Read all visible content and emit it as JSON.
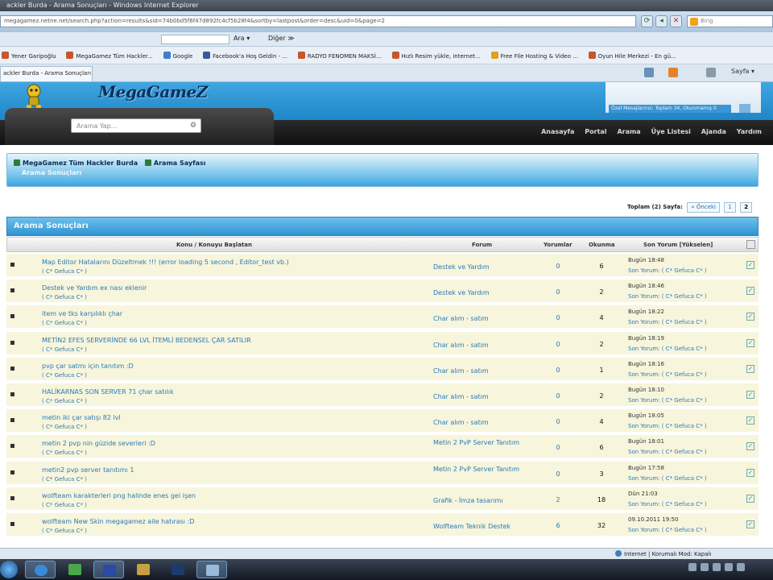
{
  "browser": {
    "window_title": "ackler Burda - Arama Sonuçları - Windows Internet Explorer",
    "url": "megagamez.netne.net/search.php?action=results&sid=74b0bd5f6f47d892fc4cf5b28f4&sortby=lastpost&order=desc&uid=0&page=2",
    "search_placeholder": "Bing",
    "menu_ara": "Ara ▾",
    "menu_diger": "Diğer ≫",
    "favorites": [
      "Yener Garipoğlu",
      "MegaGamez Tüm Hackler...",
      "Google",
      "Facebook'a Hoş Geldin - ...",
      "RADYO FENOMEN MAKSİ...",
      "Hızlı Resim yükle, internet...",
      "Free File Hosting & Video ...",
      "Oyun Hile Merkezi - En gü..."
    ],
    "tab_title": "ackler Burda - Arama Sonuçları",
    "cmd_sayfa": "Sayfa ▾",
    "status_zone": "Internet | Korumalı Mod: Kapalı"
  },
  "site": {
    "logo_text": "MegaGameZ",
    "search_placeholder": "Arama Yap...",
    "user_bar": "Özel Mesajlarınız: Toplam 34, Okunmamış 0",
    "nav": [
      "Anasayfa",
      "Portal",
      "Arama",
      "Üye Listesi",
      "Ajanda",
      "Yardım"
    ]
  },
  "breadcrumb": {
    "items": [
      "MegaGamez Tüm Hackler Burda",
      "Arama Sayfası"
    ],
    "current": "Arama Sonuçları"
  },
  "pager": {
    "label": "Toplam (2) Sayfa:",
    "prev": "« Önceki",
    "pages": [
      "1",
      "2"
    ],
    "current": "2"
  },
  "results": {
    "title": "Arama Sonuçları",
    "columns": {
      "topic": "Konu / Konuyu Başlatan",
      "forum": "Forum",
      "replies": "Yorumlar",
      "views": "Okunma",
      "last": "Son Yorum [Yükselen]"
    },
    "rows": [
      {
        "title": "Map Editor Hatalarını Düzeltmek !!! (error loading 5 second , Editor_test vb.)",
        "author": "( C* Gefuca C* )",
        "forum": "Destek ve Yardım",
        "replies": "0",
        "views": "6",
        "last_time": "Bugün 18:48",
        "last_author": "Son Yorum: ( C* Gefuca C* )"
      },
      {
        "title": "Destek ve Yardım ex nası eklenir",
        "author": "( C* Gefuca C* )",
        "forum": "Destek ve Yardım",
        "replies": "0",
        "views": "2",
        "last_time": "Bugün 18:46",
        "last_author": "Son Yorum: ( C* Gefuca C* )"
      },
      {
        "title": "item ve tks karşılıklı çhar",
        "author": "( C* Gefuca C* )",
        "forum": "Char alım - satım",
        "replies": "0",
        "views": "4",
        "last_time": "Bugün 18:22",
        "last_author": "Son Yorum: ( C* Gefuca C* )"
      },
      {
        "title": "METİN2 EFES SERVERİNDE 66 LVL İTEMLİ BEDENSEL ÇAR SATILIR",
        "author": "( C* Gefuca C* )",
        "forum": "Char alım - satım",
        "replies": "0",
        "views": "2",
        "last_time": "Bugün 18:19",
        "last_author": "Son Yorum: ( C* Gefuca C* )"
      },
      {
        "title": "pvp çar satmı için tanıtım :D",
        "author": "( C* Gefuca C* )",
        "forum": "Char alım - satım",
        "replies": "0",
        "views": "1",
        "last_time": "Bugün 18:16",
        "last_author": "Son Yorum: ( C* Gefuca C* )"
      },
      {
        "title": "HALİKARNAS SON SERVER 71 çhar satılık",
        "author": "( C* Gefuca C* )",
        "forum": "Char alım - satım",
        "replies": "0",
        "views": "2",
        "last_time": "Bugün 18:10",
        "last_author": "Son Yorum: ( C* Gefuca C* )"
      },
      {
        "title": "metin iki çar satışı 82 lvl",
        "author": "( C* Gefuca C* )",
        "forum": "Char alım - satım",
        "replies": "0",
        "views": "4",
        "last_time": "Bugün 18:05",
        "last_author": "Son Yorum: ( C* Gefuca C* )"
      },
      {
        "title": "metin 2 pvp nin güzide severleri :D",
        "author": "( C* Gefuca C* )",
        "forum": "Metin 2 PvP Server Tanıtım",
        "replies": "0",
        "views": "6",
        "last_time": "Bugün 18:01",
        "last_author": "Son Yorum: ( C* Gefuca C* )"
      },
      {
        "title": "metin2 pvp server tanıtımı 1",
        "author": "( C* Gefuca C* )",
        "forum": "Metin 2 PvP Server Tanıtım",
        "replies": "0",
        "views": "3",
        "last_time": "Bugün 17:58",
        "last_author": "Son Yorum: ( C* Gefuca C* )"
      },
      {
        "title": "wolfteam karakterleri png halinde enes gel işen",
        "author": "( C* Gefuca C* )",
        "forum": "Grafik - İmza tasarımı",
        "replies": "2",
        "views": "18",
        "last_time": "Dün 21:03",
        "last_author": "Son Yorum: ( C* Gefuca C* )"
      },
      {
        "title": "wolfteam New Skin megagamez aile hatırası :D",
        "author": "( C* Gefuca C* )",
        "forum": "Wolfteam Teknik Destek",
        "replies": "6",
        "views": "32",
        "last_time": "09.10.2011 19:50",
        "last_author": "Son Yorum: ( C* Gefuca C* )"
      }
    ]
  },
  "colors": {
    "accent": "#2f94d3",
    "row_bg": "#f7f5dc",
    "link": "#2a7ab8",
    "header_dark": "#1a1a1a"
  },
  "icons": [
    "back-icon",
    "forward-icon",
    "refresh-icon",
    "home-icon",
    "print-icon",
    "rss-icon",
    "windows-start-icon"
  ]
}
